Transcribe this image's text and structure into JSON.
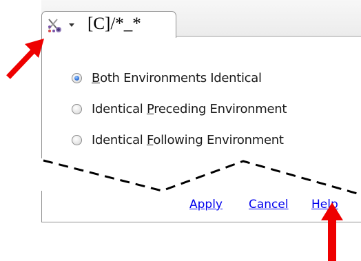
{
  "tab": {
    "title": "[C]/*_*",
    "icon": "environment-icon",
    "dropdown_icon": "chevron-down-icon"
  },
  "options": [
    {
      "prefix": "",
      "mnemonic": "B",
      "suffix": "oth Environments Identical",
      "checked": true
    },
    {
      "prefix": "Identical ",
      "mnemonic": "P",
      "suffix": "receding Environment",
      "checked": false
    },
    {
      "prefix": "Identical ",
      "mnemonic": "F",
      "suffix": "ollowing Environment",
      "checked": false
    }
  ],
  "buttons": {
    "apply": "Apply",
    "cancel": "Cancel",
    "help": "Help"
  },
  "colors": {
    "arrow": "#ee0000",
    "link": "#0000ee",
    "radio_selected": "#2f6fd6"
  }
}
